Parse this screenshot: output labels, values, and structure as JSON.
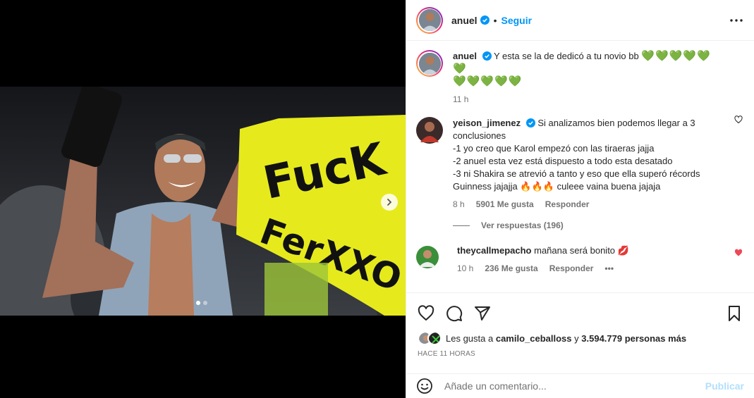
{
  "post": {
    "author": "anuel",
    "follow_label": "Seguir",
    "dot": "•",
    "caption": {
      "user": "anuel",
      "text": "Y esta se la de dedicó a tu novio bb",
      "emoji_line1": "💚💚💚💚💚💚",
      "emoji_line2": "💚💚💚💚💚",
      "time": "11 h"
    }
  },
  "image": {
    "sign_line1": "FucK",
    "sign_line2": "FerXXO"
  },
  "comments": [
    {
      "user": "yeison_jimenez",
      "lines": [
        "Si analizamos bien podemos llegar a 3 conclusiones",
        "-1 yo creo que Karol empezó con las tiraeras jajja",
        "-2 anuel esta vez está dispuesto a todo esta desatado",
        "-3 ni Shakira se atrevió a tanto y eso que ella superó récords",
        "Guinness jajajja"
      ],
      "emoji": "🔥🔥🔥",
      "tail": "culeee vaina buena jajaja",
      "time": "8 h",
      "likes": "5901 Me gusta",
      "reply": "Responder",
      "see_replies": "Ver respuestas (196)"
    },
    {
      "user": "theycallmepacho",
      "text": "mañana será bonito",
      "emoji": "💋",
      "time": "10 h",
      "likes": "236 Me gusta",
      "reply": "Responder",
      "more": "•••"
    }
  ],
  "likes_summary": {
    "prefix": "Les gusta a",
    "user": "camilo_ceballoss",
    "joiner": "y",
    "count": "3.594.779 personas más"
  },
  "time_ago": "HACE 11 HORAS",
  "add_comment": {
    "placeholder": "Añade un comentario...",
    "publish": "Publicar"
  },
  "colors": {
    "accent": "#0095f6",
    "publish_disabled": "#b2dffc",
    "liked": "#ed4956",
    "sign_yellow": "#e6ea1c"
  }
}
